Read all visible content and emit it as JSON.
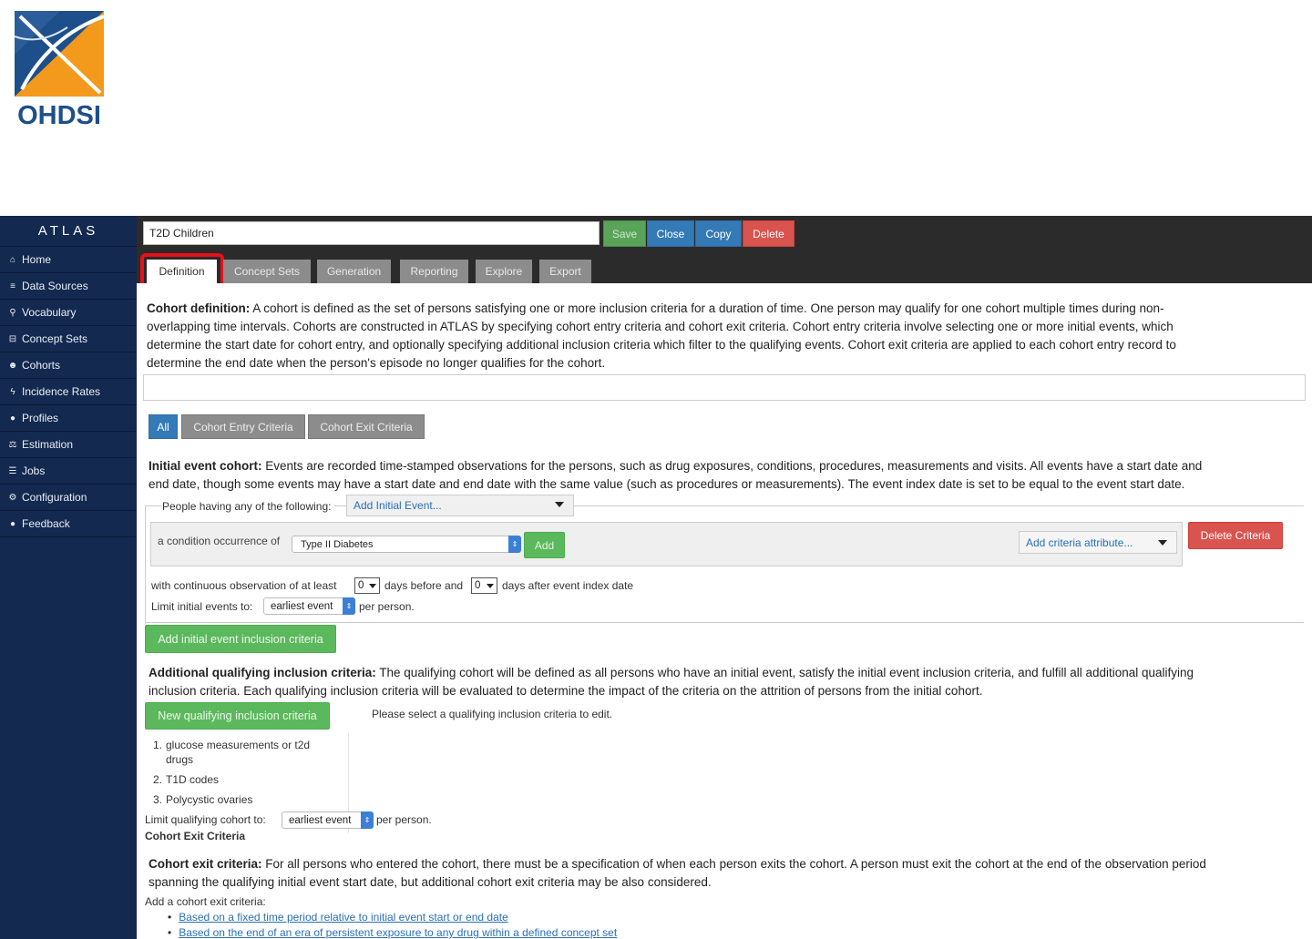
{
  "logo": {
    "text": "OHDSI"
  },
  "sidebar": {
    "brand": "ATLAS",
    "items": [
      {
        "label": "Home",
        "icon": "home-icon"
      },
      {
        "label": "Data Sources",
        "icon": "database-icon"
      },
      {
        "label": "Vocabulary",
        "icon": "search-icon"
      },
      {
        "label": "Concept Sets",
        "icon": "cart-icon"
      },
      {
        "label": "Cohorts",
        "icon": "users-icon"
      },
      {
        "label": "Incidence Rates",
        "icon": "bolt-icon"
      },
      {
        "label": "Profiles",
        "icon": "user-icon"
      },
      {
        "label": "Estimation",
        "icon": "scale-icon"
      },
      {
        "label": "Jobs",
        "icon": "list-icon"
      },
      {
        "label": "Configuration",
        "icon": "gears-icon"
      },
      {
        "label": "Feedback",
        "icon": "comment-icon"
      }
    ]
  },
  "header": {
    "cohort_name": "T2D Children",
    "save_label": "Save",
    "close_label": "Close",
    "copy_label": "Copy",
    "delete_label": "Delete",
    "tabs": [
      "Definition",
      "Concept Sets",
      "Generation",
      "Reporting",
      "Explore",
      "Export"
    ],
    "active_tab": "Definition"
  },
  "definition": {
    "intro_title": "Cohort definition:",
    "intro_lines": [
      " A cohort is defined as the set of persons satisfying one or more inclusion criteria for a duration of time. One person may qualify for one cohort multiple times during non-",
      "overlapping time intervals. Cohorts are constructed in ATLAS by specifying cohort entry criteria and cohort exit criteria. Cohort entry criteria involve selecting one or more initial events, which",
      "determine the start date for cohort entry, and optionally specifying additional inclusion criteria which filter to the qualifying events. Cohort exit criteria are applied to each cohort entry record to",
      "determine the end date when the person's episode no longer qualifies for the cohort."
    ],
    "section_tabs": [
      "All",
      "Cohort Entry Criteria",
      "Cohort Exit Criteria"
    ],
    "initial_title": "Initial event cohort:",
    "initial_lines": [
      " Events are recorded time-stamped observations for the persons, such as drug exposures, conditions, procedures, measurements and visits. All events have a start date and",
      "end date, though some events may have a start date and end date with the same value (such as procedures or measurements). The event index date is set to be equal to the event start date."
    ],
    "people_having_label": "People having any of the following:",
    "add_initial_event": "Add Initial Event...",
    "condition_label": "a condition occurrence of",
    "condition_concept": "Type II Diabetes",
    "add_label": "Add",
    "add_criteria_attribute": "Add criteria attribute...",
    "delete_criteria": "Delete Criteria",
    "obs_prefix": "with continuous observation of at least",
    "obs_before_value": "0",
    "obs_mid": "days before and",
    "obs_after_value": "0",
    "obs_suffix": "days after event index date",
    "limit_initial_label": "Limit initial events to:",
    "limit_initial_value": "earliest event",
    "per_person": "per person.",
    "add_initial_inclusion": "Add initial event inclusion criteria",
    "additional_title": "Additional qualifying inclusion criteria:",
    "additional_lines": [
      " The qualifying cohort will be defined as all persons who have an initial event, satisfy the initial event inclusion criteria, and fulfill all additional qualifying",
      "inclusion criteria. Each qualifying inclusion criteria will be evaluated to determine the impact of the criteria on the attrition of persons from the initial cohort."
    ],
    "new_qualifying": "New qualifying inclusion criteria",
    "select_prompt": "Please select a qualifying inclusion criteria to edit.",
    "inclusion_list": [
      {
        "num": "1.",
        "line1": "glucose measurements or t2d",
        "line2": "drugs"
      },
      {
        "num": "2.",
        "line1": "T1D codes",
        "line2": ""
      },
      {
        "num": "3.",
        "line1": "Polycystic ovaries",
        "line2": ""
      }
    ],
    "limit_qualifying_label": "Limit qualifying cohort to:",
    "limit_qualifying_value": "earliest event",
    "exit_heading": "Cohort Exit Criteria",
    "exit_title": "Cohort exit criteria:",
    "exit_lines": [
      " For all persons who entered the cohort, there must be a specification of when each person exits the cohort. A person must exit the cohort at the end of the observation period",
      "spanning the qualifying initial event start date, but additional cohort exit criteria may be also considered."
    ],
    "add_exit_label": "Add a cohort exit criteria:",
    "exit_options": [
      "Based on a fixed time period relative to initial event start or end date",
      "Based on the end of an era of persistent exposure to any drug within a defined concept set"
    ]
  },
  "colors": {
    "sidebar_bg": "#13294f",
    "primary_blue": "#337ab7",
    "success_green": "#5cb85c",
    "danger_red": "#d9534f",
    "highlight_red": "#e8101a",
    "logo_orange": "#f39a1c",
    "logo_blue": "#1d4f8b"
  }
}
